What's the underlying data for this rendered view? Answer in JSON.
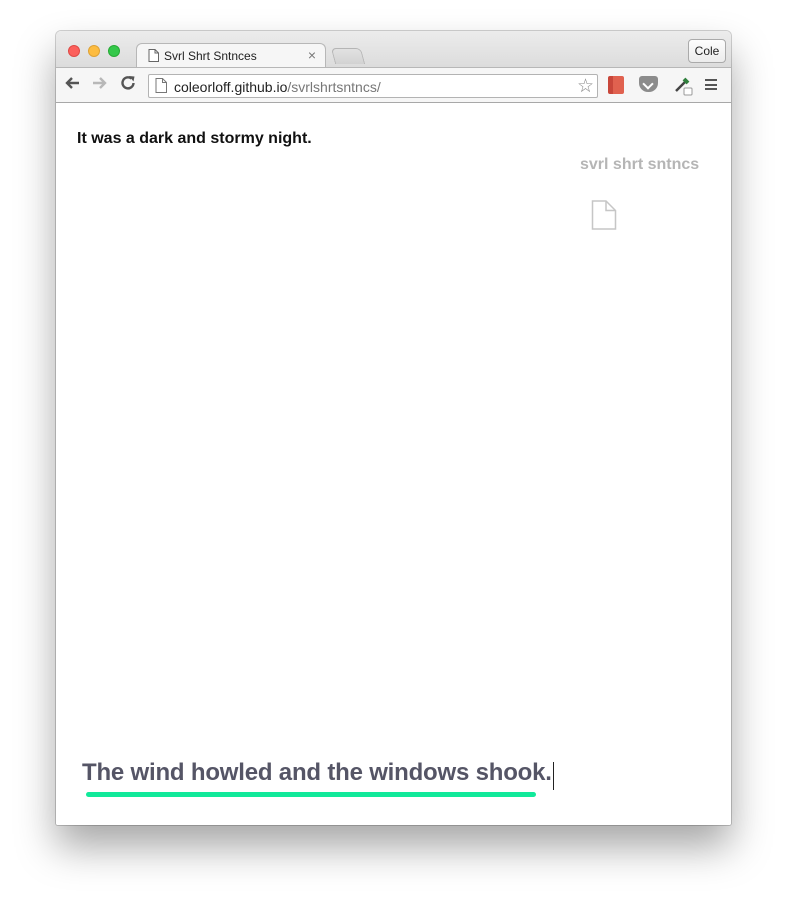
{
  "browser": {
    "tab_title": "Svrl Shrt Sntnces",
    "tab_close_glyph": "×",
    "profile_button": "Cole",
    "url_host": "coleorloff.github.io",
    "url_path": "/svrlshrtsntncs/",
    "icons": {
      "back": "back-arrow-icon",
      "forward": "forward-arrow-icon",
      "reload": "reload-icon",
      "bookmark": "star-icon",
      "menu": "hamburger-menu-icon"
    },
    "colors": {
      "close": "#fc605c",
      "minimize": "#fdbc40",
      "maximize": "#34c84a"
    }
  },
  "page": {
    "sentence": "It was a dark and stormy night.",
    "brand": "svrl shrt sntncs",
    "composer_text": "The wind howled and the windows shook.",
    "accent_color": "#11e99a"
  }
}
